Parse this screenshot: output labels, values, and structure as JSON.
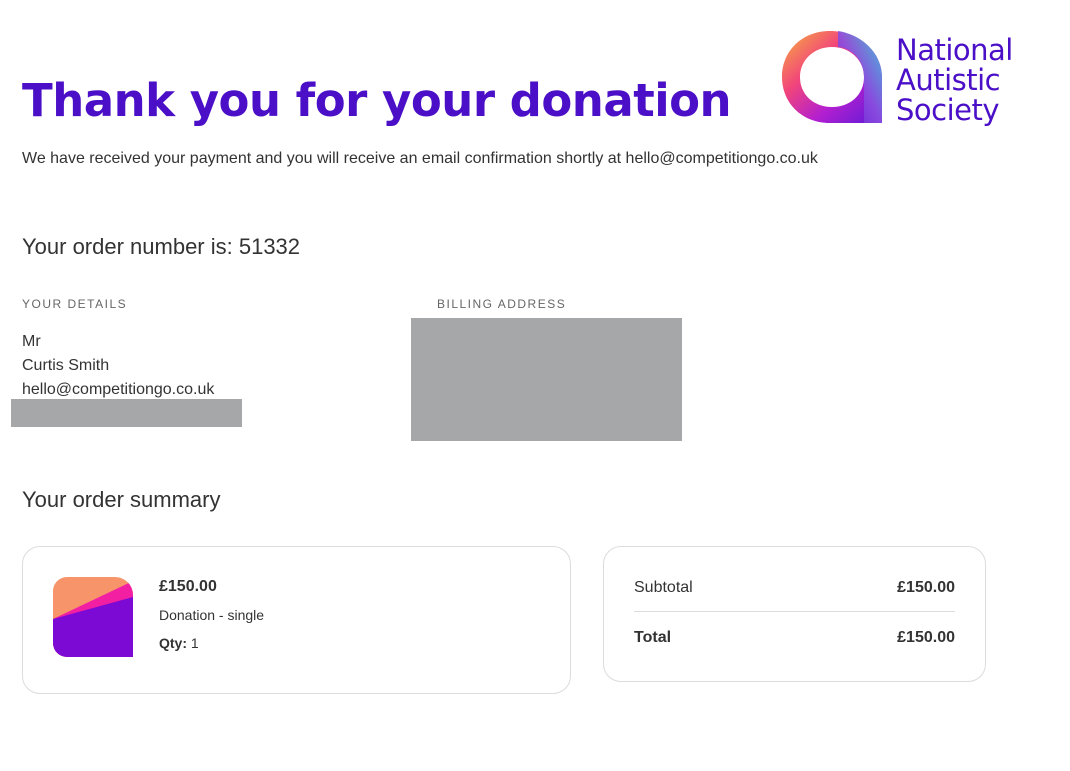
{
  "header": {
    "title": "Thank you for your donation",
    "subtitle": "We have received your payment and you will receive an email confirmation shortly at hello@competitiongo.co.uk"
  },
  "logo": {
    "line1": "National",
    "line2": "Autistic",
    "line3": "Society",
    "icon": "nas-ring-logo-icon",
    "color": "#4a0fc7"
  },
  "order": {
    "number_text": "Your order number is: 51332"
  },
  "your_details": {
    "label": "YOUR DETAILS",
    "title": "Mr",
    "name": "Curtis Smith",
    "email": "hello@competitiongo.co.uk"
  },
  "billing": {
    "label": "BILLING ADDRESS"
  },
  "summary": {
    "title": "Your order summary",
    "item": {
      "price": "£150.00",
      "name": "Donation - single",
      "qty_label": "Qty:",
      "qty_value": "1",
      "icon": "donation-thumbnail-icon"
    },
    "subtotal_label": "Subtotal",
    "subtotal_value": "£150.00",
    "total_label": "Total",
    "total_value": "£150.00"
  },
  "colors": {
    "brand": "#4a0fc7",
    "redacted": "#a6a7a9",
    "card_border": "#dcdcdc"
  }
}
